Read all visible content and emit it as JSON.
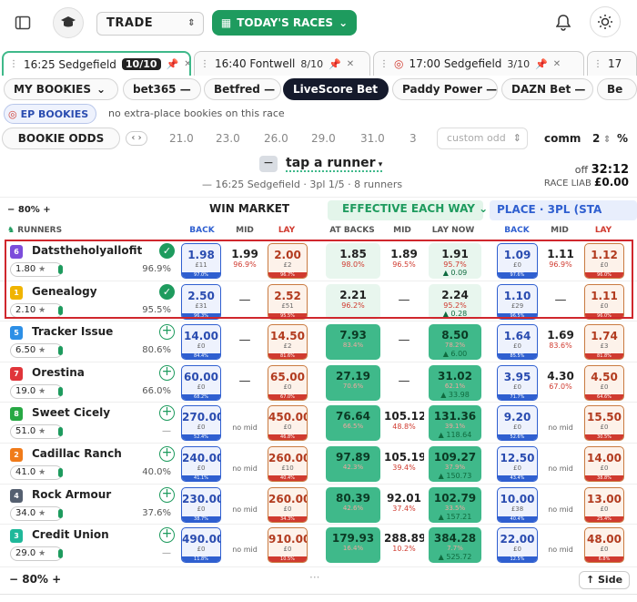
{
  "topbar": {
    "mode": "TRADE",
    "races_label": "TODAY'S RACES"
  },
  "tabs": [
    {
      "label": "16:25 Sedgefield",
      "count": "10/10"
    },
    {
      "label": "16:40 Fontwell",
      "count": "8/10"
    },
    {
      "label": "17:00 Sedgefield",
      "count": "3/10"
    },
    {
      "label": "17",
      "count": ""
    }
  ],
  "bookies": {
    "my_bookies": "MY BOOKIES",
    "items": [
      "bet365 —",
      "Betfred —",
      "LiveScore Bet",
      "Paddy Power —",
      "DAZN Bet —",
      "Be"
    ]
  },
  "ep": {
    "label": "EP BOOKIES",
    "note": "no extra-place bookies on this race"
  },
  "odds": {
    "label": "BOOKIE ODDS",
    "values": [
      "21.0",
      "23.0",
      "26.0",
      "29.0",
      "31.0",
      "3"
    ],
    "custom_placeholder": "custom odd",
    "comm_label": "comm",
    "comm_value": "2",
    "pct": "%"
  },
  "race": {
    "tap": "tap a runner",
    "subtitle": "— 16:25 Sedgefield · 3pl 1/5 · 8 runners",
    "off_label": "off",
    "off_time": "32:12",
    "liab_label": "RACE LIAB",
    "liab_value": "£0.00"
  },
  "sections": {
    "zoom": "80%",
    "win": "WIN MARKET",
    "ew": "EFFECTIVE EACH WAY",
    "place": "PLACE · 3PL (STA"
  },
  "cols": {
    "runners": "RUNNERS",
    "back": "BACK",
    "mid": "MID",
    "lay": "LAY",
    "at_backs": "AT BACKS",
    "lay_now": "LAY NOW"
  },
  "runners": [
    {
      "num": "6",
      "color": "#7c4ddb",
      "name": "Datstheholyallofit",
      "price": "1.80",
      "pct": "96.9%",
      "sel": true,
      "wb": "1.98",
      "wbs": "£11",
      "wbf": "97.0%",
      "wm": "1.99",
      "wms": "96.9%",
      "wl": "2.00",
      "wls": "£2",
      "wlf": "96.7%",
      "ea": "1.85",
      "eas": "98.0%",
      "em": "1.89",
      "ems": "96.5%",
      "en": "1.91",
      "ens": "95.7%",
      "enp": "▲ 0.09",
      "pb": "1.09",
      "pbs": "£0",
      "pbf": "97.6%",
      "pm": "1.11",
      "pms": "96.9%",
      "pl": "1.12",
      "pls": "£0",
      "plf": "96.0%"
    },
    {
      "num": "1",
      "color": "#f0b400",
      "name": "Genealogy",
      "price": "2.10",
      "pct": "95.5%",
      "sel": true,
      "wb": "2.50",
      "wbs": "£31",
      "wbf": "96.3%",
      "wm": "—",
      "wms": "",
      "wl": "2.52",
      "wls": "£51",
      "wlf": "95.5%",
      "ea": "2.21",
      "eas": "96.2%",
      "em": "—",
      "ems": "",
      "en": "2.24",
      "ens": "95.2%",
      "enp": "▲ 0.28",
      "pb": "1.10",
      "pbs": "£29",
      "pbf": "96.5%",
      "pm": "—",
      "pms": "",
      "pl": "1.11",
      "pls": "£0",
      "plf": "96.0%"
    },
    {
      "num": "5",
      "color": "#2d8fe6",
      "name": "Tracker Issue",
      "price": "6.50",
      "pct": "80.6%",
      "sel": false,
      "wb": "14.00",
      "wbs": "£0",
      "wbf": "84.4%",
      "wm": "—",
      "wms": "",
      "wl": "14.50",
      "wls": "£2",
      "wlf": "81.6%",
      "ea": "7.93",
      "eas": "83.4%",
      "em": "—",
      "ems": "",
      "en": "8.50",
      "ens": "78.2%",
      "enp": "▲ 6.00",
      "pb": "1.64",
      "pbs": "£0",
      "pbf": "85.5%",
      "pm": "1.69",
      "pms": "83.6%",
      "pl": "1.74",
      "pls": "£3",
      "plf": "81.8%"
    },
    {
      "num": "7",
      "color": "#e0353a",
      "name": "Orestina",
      "price": "19.0",
      "pct": "66.0%",
      "sel": false,
      "wb": "60.00",
      "wbs": "£0",
      "wbf": "68.2%",
      "wm": "—",
      "wms": "",
      "wl": "65.00",
      "wls": "£0",
      "wlf": "67.0%",
      "ea": "27.19",
      "eas": "70.6%",
      "em": "—",
      "ems": "",
      "en": "31.02",
      "ens": "62.1%",
      "enp": "▲ 33.98",
      "pb": "3.95",
      "pbs": "£0",
      "pbf": "71.7%",
      "pm": "4.30",
      "pms": "67.0%",
      "pl": "4.50",
      "pls": "£0",
      "plf": "64.6%"
    },
    {
      "num": "8",
      "color": "#27a844",
      "name": "Sweet Cicely",
      "price": "51.0",
      "pct": "—",
      "sel": false,
      "wb": "270.00",
      "wbs": "£0",
      "wbf": "52.4%",
      "wm": "no mid",
      "wms": "",
      "wl": "450.00",
      "wls": "£0",
      "wlf": "46.8%",
      "ea": "76.64",
      "eas": "66.5%",
      "em": "105.12",
      "ems": "48.8%",
      "en": "131.36",
      "ens": "39.1%",
      "enp": "▲ 118.64",
      "pb": "9.20",
      "pbs": "£0",
      "pbf": "52.6%",
      "pm": "no mid",
      "pms": "",
      "pl": "15.50",
      "pls": "£0",
      "plf": "30.5%"
    },
    {
      "num": "2",
      "color": "#f07b1a",
      "name": "Cadillac Ranch",
      "price": "41.0",
      "pct": "40.0%",
      "sel": false,
      "wb": "240.00",
      "wbs": "£0",
      "wbf": "41.1%",
      "wm": "no mid",
      "wms": "",
      "wl": "260.00",
      "wls": "£10",
      "wlf": "40.4%",
      "ea": "97.89",
      "eas": "42.3%",
      "em": "105.19",
      "ems": "39.4%",
      "en": "109.27",
      "ens": "37.9%",
      "enp": "▲ 150.73",
      "pb": "12.50",
      "pbs": "£0",
      "pbf": "43.4%",
      "pm": "no mid",
      "pms": "",
      "pl": "14.00",
      "pls": "£0",
      "plf": "38.8%"
    },
    {
      "num": "4",
      "color": "#556070",
      "name": "Rock Armour",
      "price": "34.0",
      "pct": "37.6%",
      "sel": false,
      "wb": "230.00",
      "wbs": "£0",
      "wbf": "38.7%",
      "wm": "no mid",
      "wms": "",
      "wl": "260.00",
      "wls": "£0",
      "wlf": "34.3%",
      "ea": "80.39",
      "eas": "42.6%",
      "em": "92.01",
      "ems": "37.4%",
      "en": "102.79",
      "ens": "33.5%",
      "enp": "▲ 157.21",
      "pb": "10.00",
      "pbs": "£38",
      "pbf": "40.4%",
      "pm": "no mid",
      "pms": "",
      "pl": "13.00",
      "pls": "£0",
      "plf": "25.4%"
    },
    {
      "num": "3",
      "color": "#1fb89a",
      "name": "Credit Union",
      "price": "29.0",
      "pct": "—",
      "sel": false,
      "wb": "490.00",
      "wbs": "£0",
      "wbf": "11.8%",
      "wm": "no mid",
      "wms": "",
      "wl": "910.00",
      "wls": "£0",
      "wlf": "10.5%",
      "ea": "179.93",
      "eas": "16.4%",
      "em": "288.89",
      "ems": "10.2%",
      "en": "384.28",
      "ens": "7.7%",
      "enp": "▲ 525.72",
      "pb": "22.00",
      "pbs": "£0",
      "pbf": "12.5%",
      "pm": "no mid",
      "pms": "",
      "pl": "48.00",
      "pls": "£0",
      "plf": "6.8%"
    }
  ],
  "bottom": {
    "zoom": "80%",
    "side": "↑ Side"
  }
}
